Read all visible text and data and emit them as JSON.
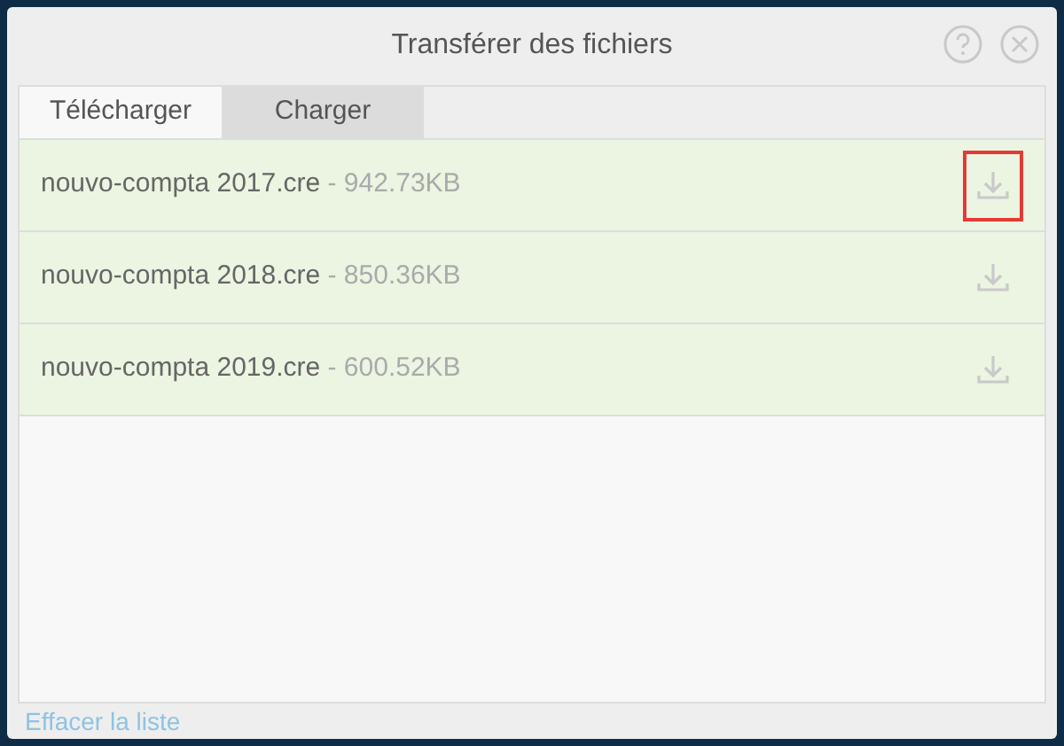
{
  "window": {
    "title": "Transférer des fichiers"
  },
  "tabs": [
    {
      "label": "Télécharger",
      "selected": true
    },
    {
      "label": "Charger",
      "selected": false
    }
  ],
  "files": [
    {
      "name": "nouvo-compta 2017.cre",
      "separator": "-",
      "size": "942.73KB",
      "highlighted": true
    },
    {
      "name": "nouvo-compta 2018.cre",
      "separator": "-",
      "size": "850.36KB",
      "highlighted": false
    },
    {
      "name": "nouvo-compta 2019.cre",
      "separator": "-",
      "size": "600.52KB",
      "highlighted": false
    }
  ],
  "footer_link": "Effacer la liste"
}
